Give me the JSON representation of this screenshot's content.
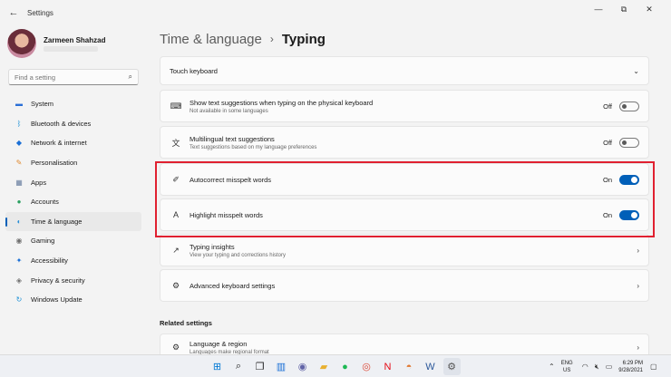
{
  "window": {
    "app_title": "Settings",
    "back_icon": "back-arrow-icon",
    "minimize_glyph": "—",
    "maximize_glyph": "⧉",
    "close_glyph": "✕"
  },
  "sidebar": {
    "profile_name": "Zarmeen Shahzad",
    "search_placeholder": "Find a setting",
    "items": [
      {
        "label": "System",
        "icon": "monitor-icon",
        "color": "#2a6fd6"
      },
      {
        "label": "Bluetooth & devices",
        "icon": "bluetooth-icon",
        "color": "#1a8fd6"
      },
      {
        "label": "Network & internet",
        "icon": "wifi-icon",
        "color": "#1a6fd6"
      },
      {
        "label": "Personalisation",
        "icon": "brush-icon",
        "color": "#e08a30"
      },
      {
        "label": "Apps",
        "icon": "apps-icon",
        "color": "#6a7fa0"
      },
      {
        "label": "Accounts",
        "icon": "person-icon",
        "color": "#2aa060"
      },
      {
        "label": "Time & language",
        "icon": "globe-clock-icon",
        "color": "#2a8fd6"
      },
      {
        "label": "Gaming",
        "icon": "gamepad-icon",
        "color": "#707070"
      },
      {
        "label": "Accessibility",
        "icon": "accessibility-icon",
        "color": "#1a6fd6"
      },
      {
        "label": "Privacy & security",
        "icon": "shield-icon",
        "color": "#707070"
      },
      {
        "label": "Windows Update",
        "icon": "update-icon",
        "color": "#1a8fd6"
      }
    ],
    "active_index": 6
  },
  "main": {
    "breadcrumb_parent": "Time & language",
    "breadcrumb_sep": "›",
    "breadcrumb_current": "Typing",
    "cards": [
      {
        "title": "Touch keyboard",
        "sub": "",
        "control": "expand"
      },
      {
        "title": "Show text suggestions when typing on the physical keyboard",
        "sub": "Not available in some languages",
        "control": "toggle",
        "state": "Off"
      },
      {
        "title": "Multilingual text suggestions",
        "sub": "Text suggestions based on my language preferences",
        "control": "toggle",
        "state": "Off"
      },
      {
        "title": "Autocorrect misspelt words",
        "sub": "",
        "control": "toggle",
        "state": "On"
      },
      {
        "title": "Highlight misspelt words",
        "sub": "",
        "control": "toggle",
        "state": "On"
      },
      {
        "title": "Typing insights",
        "sub": "View your typing and corrections history",
        "control": "nav"
      },
      {
        "title": "Advanced keyboard settings",
        "sub": "",
        "control": "nav"
      }
    ],
    "related_heading": "Related settings",
    "related_cards": [
      {
        "title": "Language & region",
        "sub": "Languages make regional format",
        "control": "nav"
      }
    ]
  },
  "colors": {
    "accent": "#005fb8",
    "highlight_border": "#e02030"
  },
  "taskbar": {
    "apps": [
      "windows-start-icon",
      "search-icon",
      "task-view-icon",
      "widgets-icon",
      "teams-chat-icon",
      "file-explorer-icon",
      "spotify-icon",
      "chrome-icon",
      "netflix-icon",
      "photos-icon",
      "word-icon",
      "settings-icon"
    ],
    "lang_line1": "ENG",
    "lang_line2": "US",
    "time": "6:29 PM",
    "date": "9/28/2021"
  }
}
